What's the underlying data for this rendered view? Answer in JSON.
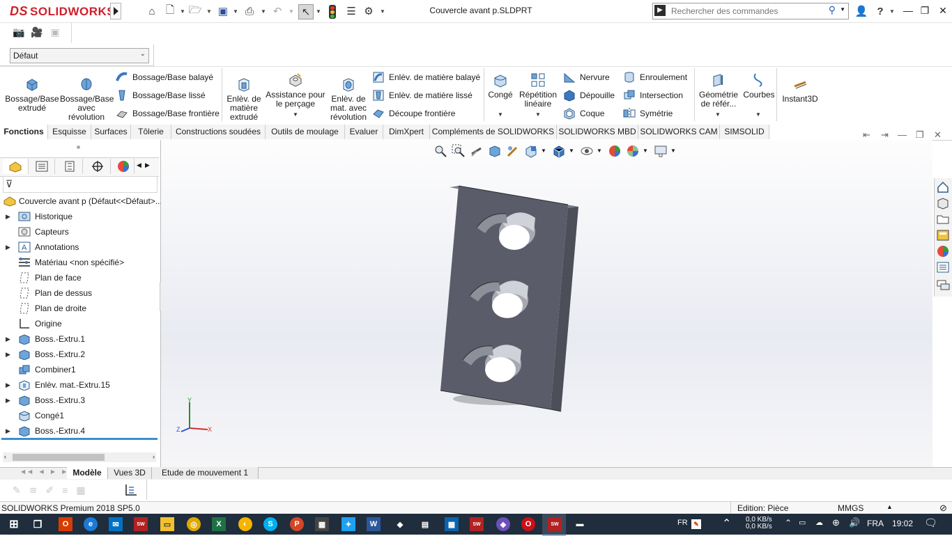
{
  "app": {
    "logo_text": "SOLIDWORKS",
    "document_title": "Couvercle avant p.SLDPRT",
    "search_placeholder": "Rechercher des commandes",
    "help_label": "?"
  },
  "config": {
    "selected": "Défaut"
  },
  "command_manager": {
    "bossage_extrude": "Bossage/Base extrudé",
    "bossage_revolution": "Bossage/Base avec révolution",
    "bossage_balaye": "Bossage/Base balayé",
    "bossage_lisse": "Bossage/Base lissé",
    "bossage_frontiere": "Bossage/Base frontière",
    "enlev_matiere": "Enlèv. de matière extrudé",
    "assistance_percage": "Assistance pour le perçage",
    "enlev_revolution": "Enlèv. de mat. avec révolution",
    "enlev_balaye": "Enlèv. de matière balayé",
    "enlev_lisse": "Enlèv. de matière lissé",
    "decoupe_frontiere": "Découpe frontière",
    "conge": "Congé",
    "repetition_lineaire": "Répétition linéaire",
    "nervure": "Nervure",
    "depouille": "Dépouille",
    "coque": "Coque",
    "enroulement": "Enroulement",
    "intersection": "Intersection",
    "symetrie": "Symétrie",
    "geometrie_reference": "Géométrie de référ...",
    "courbes": "Courbes",
    "instant3d": "Instant3D"
  },
  "tabs": [
    {
      "label": "Fonctions",
      "active": true
    },
    {
      "label": "Esquisse"
    },
    {
      "label": "Surfaces"
    },
    {
      "label": "Tôlerie"
    },
    {
      "label": "Constructions soudées"
    },
    {
      "label": "Outils de moulage"
    },
    {
      "label": "Evaluer"
    },
    {
      "label": "DimXpert"
    },
    {
      "label": "Compléments de SOLIDWORKS"
    },
    {
      "label": "SOLIDWORKS MBD"
    },
    {
      "label": "SOLIDWORKS CAM"
    },
    {
      "label": "SIMSOLID"
    }
  ],
  "tree": {
    "root": "Couvercle avant p  (Défaut<<Défaut>...",
    "items": [
      {
        "label": "Historique",
        "icon": "folder-history-icon",
        "expandable": true
      },
      {
        "label": "Capteurs",
        "icon": "sensor-icon",
        "expandable": false
      },
      {
        "label": "Annotations",
        "icon": "annotation-icon",
        "expandable": true
      },
      {
        "label": "Matériau <non spécifié>",
        "icon": "material-icon",
        "expandable": false
      },
      {
        "label": "Plan de face",
        "icon": "plane-icon",
        "expandable": false
      },
      {
        "label": "Plan de dessus",
        "icon": "plane-icon",
        "expandable": false
      },
      {
        "label": "Plan de droite",
        "icon": "plane-icon",
        "expandable": false
      },
      {
        "label": "Origine",
        "icon": "origin-icon",
        "expandable": false
      },
      {
        "label": "Boss.-Extru.1",
        "icon": "extrude-icon",
        "expandable": true
      },
      {
        "label": "Boss.-Extru.2",
        "icon": "extrude-icon",
        "expandable": true
      },
      {
        "label": "Combiner1",
        "icon": "combine-icon",
        "expandable": false
      },
      {
        "label": "Enlèv. mat.-Extru.15",
        "icon": "cut-extrude-icon",
        "expandable": true
      },
      {
        "label": "Boss.-Extru.3",
        "icon": "extrude-icon",
        "expandable": true
      },
      {
        "label": "Congé1",
        "icon": "fillet-icon",
        "expandable": false
      },
      {
        "label": "Boss.-Extru.4",
        "icon": "extrude-icon",
        "expandable": true
      }
    ]
  },
  "bottom_tabs": [
    {
      "label": "Modèle",
      "active": true
    },
    {
      "label": "Vues 3D"
    },
    {
      "label": "Etude de mouvement 1"
    }
  ],
  "status": {
    "product": "SOLIDWORKS Premium 2018 SP5.0",
    "edition": "Edition: Pièce",
    "units": "MMGS"
  },
  "taskbar": {
    "lang_short": "FR",
    "net_up": "0,0 KB/s",
    "net_down": "0,0 KB/s",
    "lang": "FRA",
    "time": "19:02"
  },
  "colors": {
    "brand_red": "#d0202a",
    "part_gray": "#50535e",
    "taskbar": "#1f2d3d"
  }
}
